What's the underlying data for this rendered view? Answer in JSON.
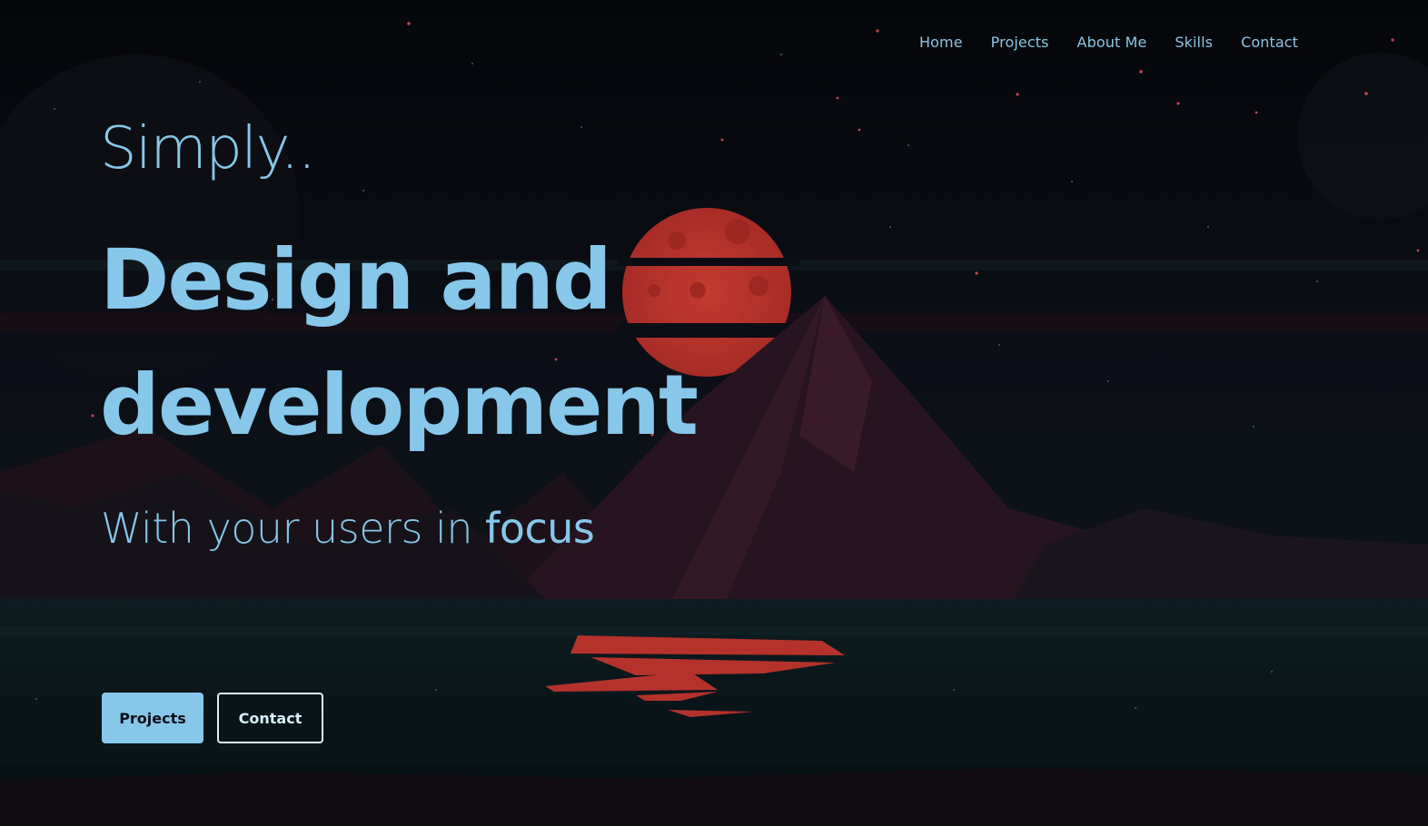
{
  "nav": {
    "items": [
      "Home",
      "Projects",
      "About Me",
      "Skills",
      "Contact"
    ]
  },
  "hero": {
    "kicker": "Simply..",
    "title_line1": "Design and",
    "title_line2": "development",
    "subtitle_prefix": "With your users in ",
    "subtitle_emphasis": "focus"
  },
  "buttons": {
    "primary": "Projects",
    "secondary": "Contact"
  },
  "colors": {
    "accent": "#86c7ea",
    "background": "#07080d",
    "sun": "#b8332d",
    "mountains": "#2b1621"
  }
}
